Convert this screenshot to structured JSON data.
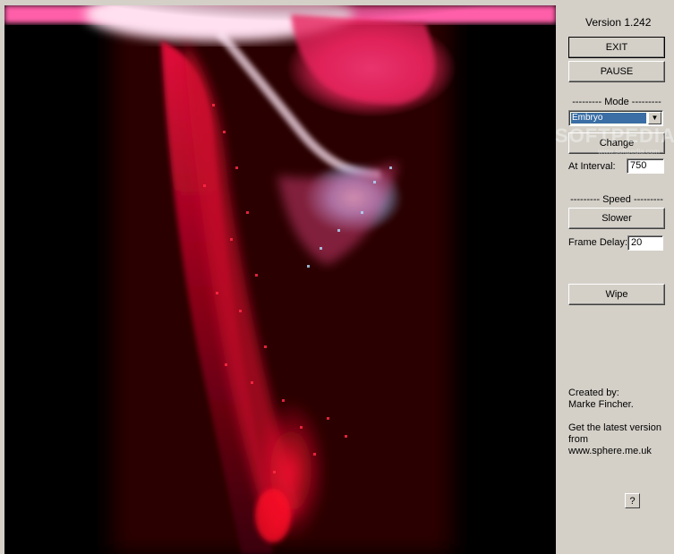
{
  "version": "Version 1.242",
  "buttons": {
    "exit": "EXIT",
    "pause": "PAUSE",
    "change": "Change",
    "slower": "Slower",
    "wipe": "Wipe",
    "help": "?"
  },
  "mode": {
    "section_title": "--------- Mode ---------",
    "selected": "Embryo",
    "interval_label": "At Interval:",
    "interval_value": "750"
  },
  "speed": {
    "section_title": "--------- Speed ---------",
    "frame_delay_label": "Frame Delay:",
    "frame_delay_value": "20"
  },
  "credits": {
    "created_by": "Created by:",
    "author": "Marke Fincher.",
    "latest_line1": "Get the latest version",
    "latest_line2": "from",
    "website": "www.sphere.me.uk"
  },
  "watermark": {
    "main": "SOFTPEDIA",
    "sub": "www.softpedia.com"
  },
  "colors": {
    "panel_bg": "#d4d0c8",
    "canvas_bg": "#000000",
    "select_highlight": "#3a6ea5"
  }
}
